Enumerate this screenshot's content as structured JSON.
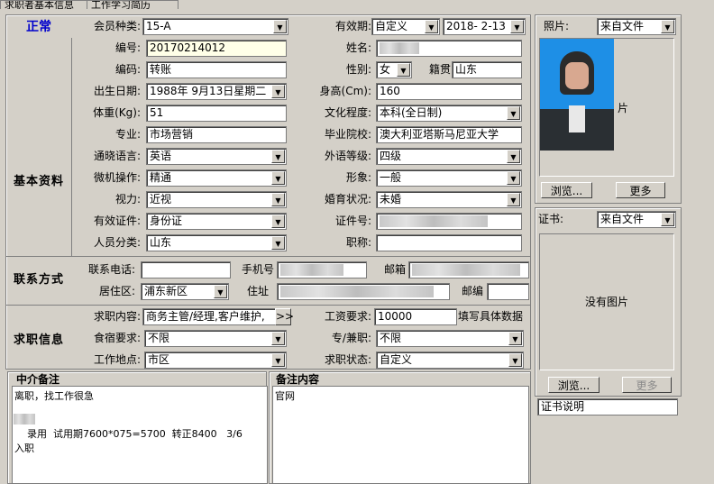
{
  "tabs": [
    "求职者基本信息",
    "工作学习简历"
  ],
  "status": "正常",
  "sections": {
    "basic": "基本资料",
    "contact": "联系方式",
    "job": "求职信息"
  },
  "labels": {
    "member_type": "会员种类:",
    "validity": "有效期:",
    "photo": "照片:",
    "serial_no": "编号:",
    "name": "姓名:",
    "code": "编码:",
    "gender": "性别:",
    "native": "籍贯",
    "birth": "出生日期:",
    "height": "身高(Cm):",
    "weight": "体重(Kg):",
    "education": "文化程度:",
    "major": "专业:",
    "school": "毕业院校:",
    "language": "通晓语言:",
    "lang_level": "外语等级:",
    "computer": "微机操作:",
    "appearance": "形象:",
    "eyesight": "视力:",
    "marital": "婚育状况:",
    "id_type": "有效证件:",
    "id_no": "证件号:",
    "category": "人员分类:",
    "title": "职称:",
    "phone": "联系电话:",
    "mobile": "手机号",
    "email": "邮箱",
    "district": "居住区:",
    "address": "住址",
    "postcode": "邮编",
    "job_content": "求职内容:",
    "salary": "工资要求:",
    "salary_hint": "填写具体数据",
    "board": "食宿要求:",
    "fulltime": "专/兼职:",
    "location": "工作地点:",
    "job_status": "求职状态:",
    "cert": "证书:"
  },
  "values": {
    "member_type": "15-A",
    "validity": "自定义",
    "valid_date": "2018- 2-13",
    "photo_src": "来自文件",
    "serial_no": "20170214012",
    "code": "转账",
    "gender": "女",
    "native": "山东",
    "birth": "1988年 9月13日星期二",
    "height": "160",
    "weight": "51",
    "education": "本科(全日制)",
    "major": "市场营销",
    "school": "澳大利亚塔斯马尼亚大学",
    "language": "英语",
    "lang_level": "四级",
    "computer": "精通",
    "appearance": "一般",
    "eyesight": "近视",
    "marital": "未婚",
    "id_type": "身份证",
    "category": "山东",
    "title": "",
    "phone": "",
    "district": "浦东新区",
    "postcode": "",
    "job_content": "商务主管/经理,客户维护,",
    "salary": "10000",
    "board": "不限",
    "fulltime": "不限",
    "location": "市区",
    "job_status": "自定义",
    "cert_src": "来自文件",
    "cert_caption": "证书说明"
  },
  "photo": {
    "side_text": "片"
  },
  "buttons": {
    "browse": "浏览...",
    "more": "更多",
    "cert_browse": "浏览...",
    "cert_more": "更多",
    "expand": ">>"
  },
  "cert": {
    "no_image": "没有图片"
  },
  "notes": {
    "agent_title": "中介备注",
    "agent_text": "离职，找工作很急\n\n\n    录用  试用期7600*075=5700  转正8400   3/6\n入职",
    "content_title": "备注内容",
    "content_text": "官网"
  },
  "colors": {
    "status": "#0000cc",
    "photo_bg": "#1e8fe6"
  }
}
